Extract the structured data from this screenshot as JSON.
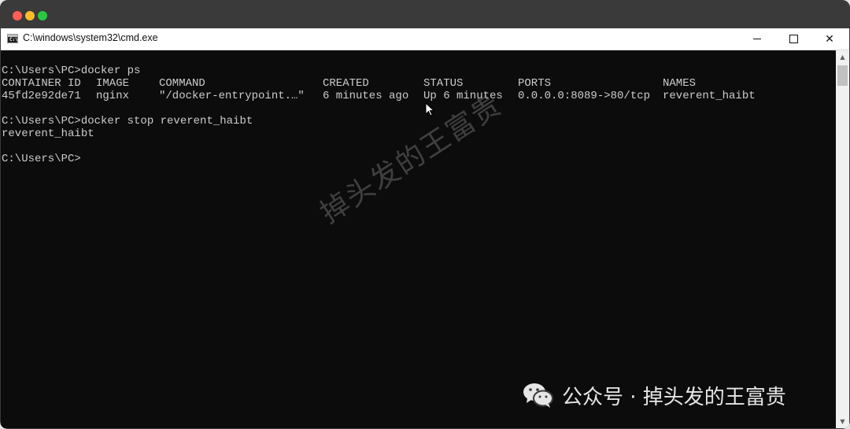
{
  "window": {
    "title": "C:\\windows\\system32\\cmd.exe",
    "icon": "cmd-app-icon",
    "icon_text": "C:\\"
  },
  "colors": {
    "console_bg": "#0c0c0c",
    "console_text": "#cccccc",
    "mac_red": "#ff5f57",
    "mac_yellow": "#febc2e",
    "mac_green": "#28c840"
  },
  "console": {
    "line1": "C:\\Users\\PC>docker ps",
    "headers": {
      "container_id": "CONTAINER ID",
      "image": "IMAGE",
      "command": "COMMAND",
      "created": "CREATED",
      "status": "STATUS",
      "ports": "PORTS",
      "names": "NAMES"
    },
    "row": {
      "container_id": "45fd2e92de71",
      "image": "nginx",
      "command": "\"/docker-entrypoint.…\"",
      "created": "6 minutes ago",
      "status": "Up 6 minutes",
      "ports": "0.0.0.0:8089->80/tcp",
      "names": "reverent_haibt"
    },
    "line4": "C:\\Users\\PC>docker stop reverent_haibt",
    "line5": "reverent_haibt",
    "line6": "C:\\Users\\PC>"
  },
  "watermark": {
    "diagonal": "掉头发的王富贵",
    "bottom": "公众号 · 掉头发的王富贵"
  }
}
